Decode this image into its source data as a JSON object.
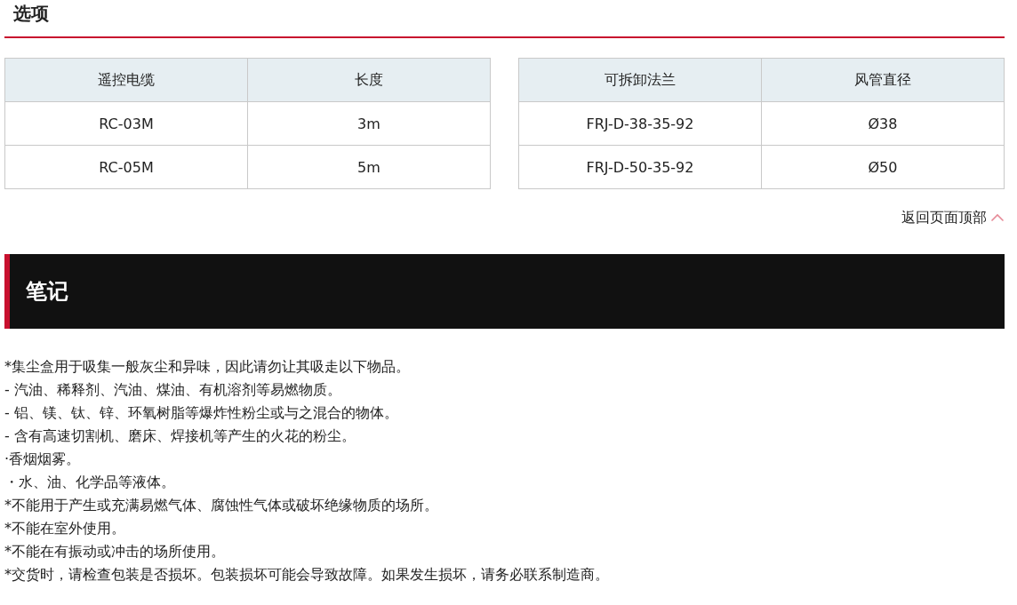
{
  "section_title": "选项",
  "tables": [
    {
      "columns": [
        "遥控电缆",
        "长度"
      ],
      "rows": [
        [
          "RC-03M",
          "3m"
        ],
        [
          "RC-05M",
          "5m"
        ]
      ]
    },
    {
      "columns": [
        "可拆卸法兰",
        "风管直径"
      ],
      "rows": [
        [
          "FRJ-D-38-35-92",
          "Ø38"
        ],
        [
          "FRJ-D-50-35-92",
          "Ø50"
        ]
      ]
    }
  ],
  "back_to_top": "返回页面顶部",
  "notes": {
    "title": "笔记",
    "lines": [
      "*集尘盒用于吸集一般灰尘和异味，因此请勿让其吸走以下物品。",
      "- 汽油、稀释剂、汽油、煤油、有机溶剂等易燃物质。",
      "- 铝、镁、钛、锌、环氧树脂等爆炸性粉尘或与之混合的物体。",
      "- 含有高速切割机、磨床、焊接机等产生的火花的粉尘。",
      "·香烟烟雾。",
      "・水、油、化学品等液体。",
      "*不能用于产生或充满易燃气体、腐蚀性气体或破坏绝缘物质的场所。",
      "*不能在室外使用。",
      "*不能在有振动或冲击的场所使用。",
      "*交货时，请检查包装是否损坏。包装损坏可能会导致故障。如果发生损坏，请务必联系制造商。"
    ]
  }
}
